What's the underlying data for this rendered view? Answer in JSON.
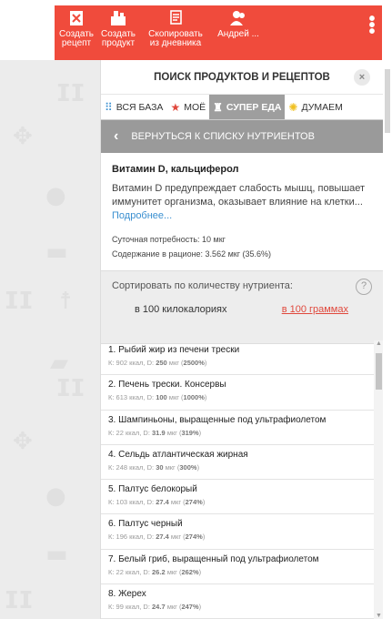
{
  "toolbar": {
    "create_recipe": [
      "Создать",
      "рецепт"
    ],
    "create_product": [
      "Создать",
      "продукт"
    ],
    "copy_diary": [
      "Скопировать",
      "из дневника"
    ],
    "user": "Андрей ..."
  },
  "panel": {
    "title": "ПОИСК ПРОДУКТОВ И РЕЦЕПТОВ",
    "close": "×"
  },
  "tabs": [
    {
      "label": "ВСЯ БАЗА",
      "icon": "tree-icon"
    },
    {
      "label": "МОЁ",
      "icon": "star-icon"
    },
    {
      "label": "СУПЕР ЕДА",
      "icon": "trophy-icon",
      "active": true
    },
    {
      "label": "ДУМАЕМ",
      "icon": "bulb-icon"
    }
  ],
  "back": {
    "label": "ВЕРНУТЬСЯ К СПИСКУ НУТРИЕНТОВ"
  },
  "nutrient": {
    "name": "Витамин D, кальциферол",
    "description": "Витамин D предупреждает слабость мышц, повышает иммунитет организма, оказывает влияние на клетки...",
    "more": "Подробнее...",
    "daily_need": "Суточная потребность: 10 мкг",
    "diet_content": "Содержание в рационе: 3.562 мкг (35.6%)"
  },
  "sort": {
    "title": "Сортировать по количеству нутриента:",
    "option1": "в 100 килокалориях",
    "option2": "в 100 граммах",
    "help": "?"
  },
  "items": [
    {
      "name": "1. Рыбий жир из печени трески",
      "kcal": "902",
      "d": "250",
      "pct": "2500%"
    },
    {
      "name": "2. Печень трески. Консервы",
      "kcal": "613",
      "d": "100",
      "pct": "1000%"
    },
    {
      "name": "3. Шампиньоны, выращенные под ультрафиолетом",
      "kcal": "22",
      "d": "31.9",
      "pct": "319%"
    },
    {
      "name": "4. Сельдь атлантическая жирная",
      "kcal": "248",
      "d": "30",
      "pct": "300%"
    },
    {
      "name": "5. Палтус белокорый",
      "kcal": "103",
      "d": "27.4",
      "pct": "274%"
    },
    {
      "name": "6. Палтус черный",
      "kcal": "196",
      "d": "27.4",
      "pct": "274%"
    },
    {
      "name": "7. Белый гриб, выращенный под ультрафиолетом",
      "kcal": "22",
      "d": "26.2",
      "pct": "262%"
    },
    {
      "name": "8. Жерех",
      "kcal": "99",
      "d": "24.7",
      "pct": "247%"
    }
  ],
  "colors": {
    "accent": "#f04b3c",
    "link": "#3a8fd0",
    "tab_active": "#9e9e9e"
  }
}
